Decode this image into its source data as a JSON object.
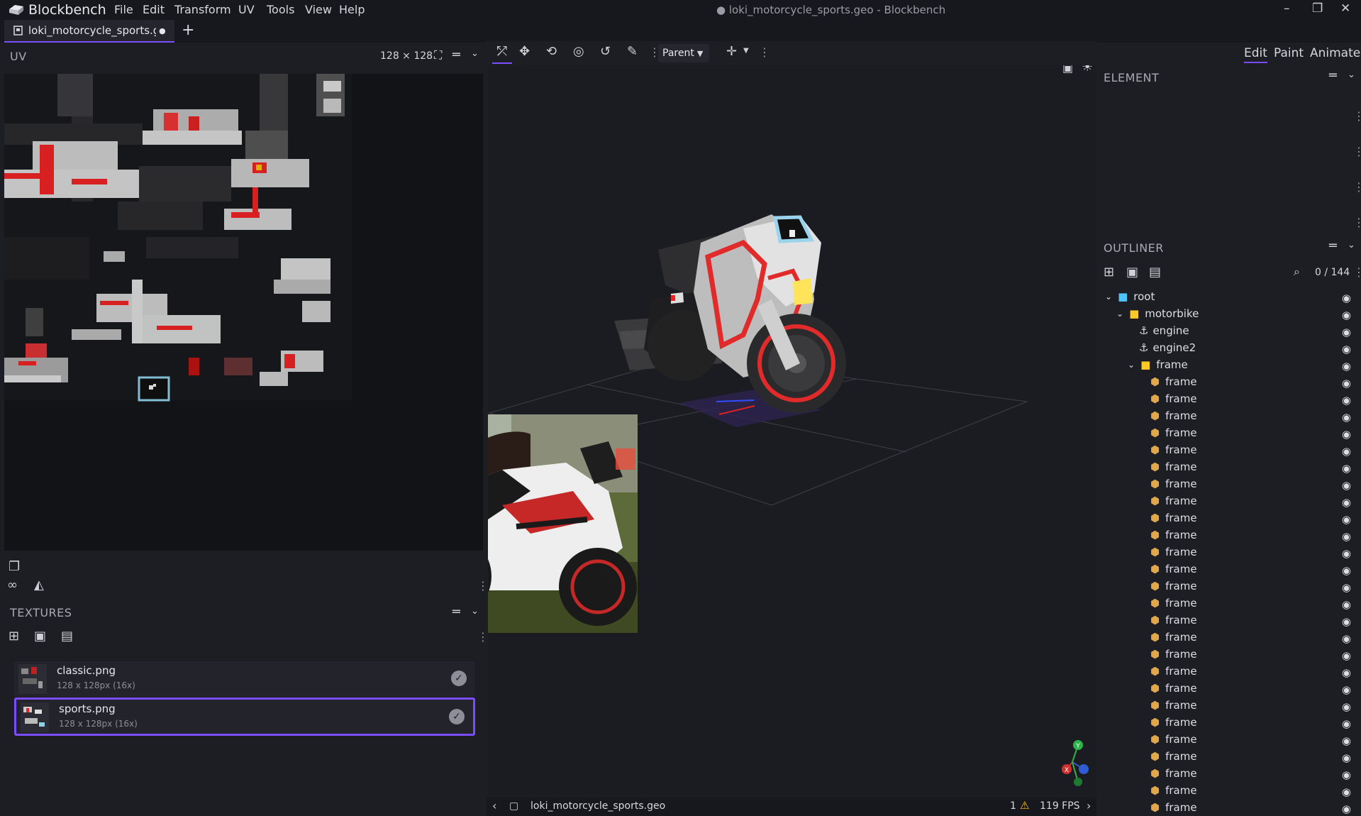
{
  "titlebar": {
    "app_name": "Blockbench",
    "menu": [
      "File",
      "Edit",
      "Transform",
      "UV",
      "Tools",
      "View",
      "Help"
    ],
    "window_title": "● loki_motorcycle_sports.geo - Blockbench",
    "minimize": "–",
    "restore": "❐",
    "close": "✕"
  },
  "tabs": {
    "file_tab_label": "loki_motorcycle_sports.geo",
    "modified_dot": "●",
    "add_tab": "+"
  },
  "uv_panel": {
    "title": "UV",
    "size_label": "128 ⨯ 128"
  },
  "viewport_toolbar": {
    "pivot_mode": "Parent"
  },
  "textures": {
    "title": "TEXTURES",
    "items": [
      {
        "name": "classic.png",
        "info": "128 x 128px (16x)",
        "selected": false
      },
      {
        "name": "sports.png",
        "info": "128 x 128px (16x)",
        "selected": true
      }
    ]
  },
  "mode_tabs": {
    "edit": "Edit",
    "paint": "Paint",
    "animate": "Animate"
  },
  "element_panel": {
    "title": "ELEMENT"
  },
  "outliner": {
    "title": "OUTLINER",
    "count": "0 / 144",
    "root": "root",
    "group": "motorbike",
    "locators": [
      "engine",
      "engine2"
    ],
    "subgroup": "frame",
    "cubes": [
      "frame",
      "frame",
      "frame",
      "frame",
      "frame",
      "frame",
      "frame",
      "frame",
      "frame",
      "frame",
      "frame",
      "frame",
      "frame",
      "frame",
      "frame",
      "frame",
      "frame",
      "frame",
      "frame",
      "frame",
      "frame",
      "frame",
      "frame",
      "frame",
      "frame",
      "frame"
    ]
  },
  "status": {
    "file": "loki_motorcycle_sports.geo",
    "warnings": "1",
    "fps": "119 FPS"
  },
  "gizmo": {
    "y": "Y",
    "x": "X"
  },
  "colors": {
    "accent": "#7c4dff",
    "folder": "#4fc3f7",
    "group_folder": "#ffca28",
    "cube": "#e0a84a",
    "warning": "#ffc107"
  }
}
